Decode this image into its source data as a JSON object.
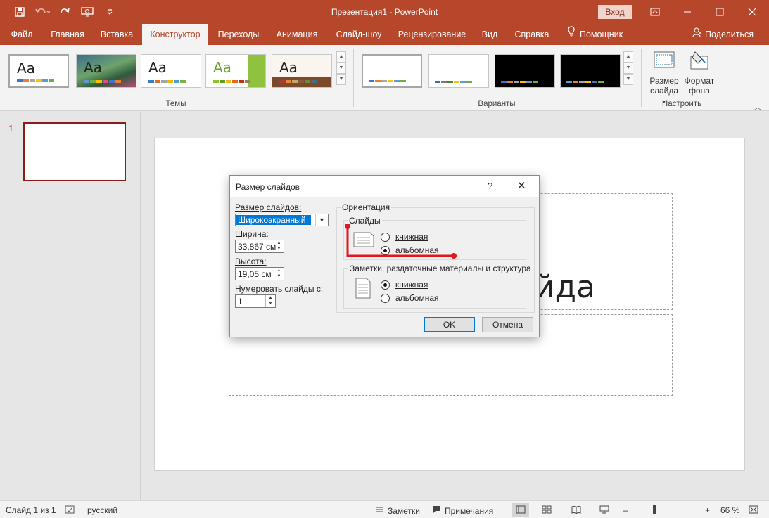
{
  "app": {
    "title": "Презентация1  -  PowerPoint",
    "sign_in": "Вход"
  },
  "tabs": [
    "Файл",
    "Главная",
    "Вставка",
    "Конструктор",
    "Переходы",
    "Анимация",
    "Слайд-шоу",
    "Рецензирование",
    "Вид",
    "Справка"
  ],
  "active_tab": "Конструктор",
  "helper": "Помощник",
  "share": "Поделиться",
  "ribbon": {
    "themes_label": "Темы",
    "theme_text": "Aa",
    "variants_label": "Варианты",
    "customize_label": "Настроить",
    "slide_size_line1": "Размер",
    "slide_size_line2": "слайда",
    "format_bg_line1": "Формат",
    "format_bg_line2": "фона"
  },
  "slides_panel": {
    "slide_number": "1"
  },
  "slide": {
    "title_fragment": "йда"
  },
  "dialog": {
    "title": "Размер слайдов",
    "help": "?",
    "close": "✕",
    "size_label": "Размер слайдов:",
    "size_value": "Широкоэкранный",
    "width_label": "Ширина:",
    "width_value": "33,867 см",
    "height_label": "Высота:",
    "height_value": "19,05 см",
    "number_from_label": "Нумеровать слайды с:",
    "number_from_value": "1",
    "orientation_label": "Ориентация",
    "slides_group_label": "Слайды",
    "notes_group_label": "Заметки, раздаточные материалы и структура",
    "portrait": "книжная",
    "landscape": "альбомная",
    "slides_orientation": "landscape",
    "notes_orientation": "portrait",
    "ok": "OK",
    "cancel": "Отмена"
  },
  "statusbar": {
    "slide_counter": "Слайд 1 из 1",
    "language": "русский",
    "notes": "Заметки",
    "comments": "Примечания",
    "zoom": "66 %",
    "zoom_level_percent": 66
  },
  "colors": {
    "accent": "#b7472a",
    "annotation": "#e0191f"
  }
}
